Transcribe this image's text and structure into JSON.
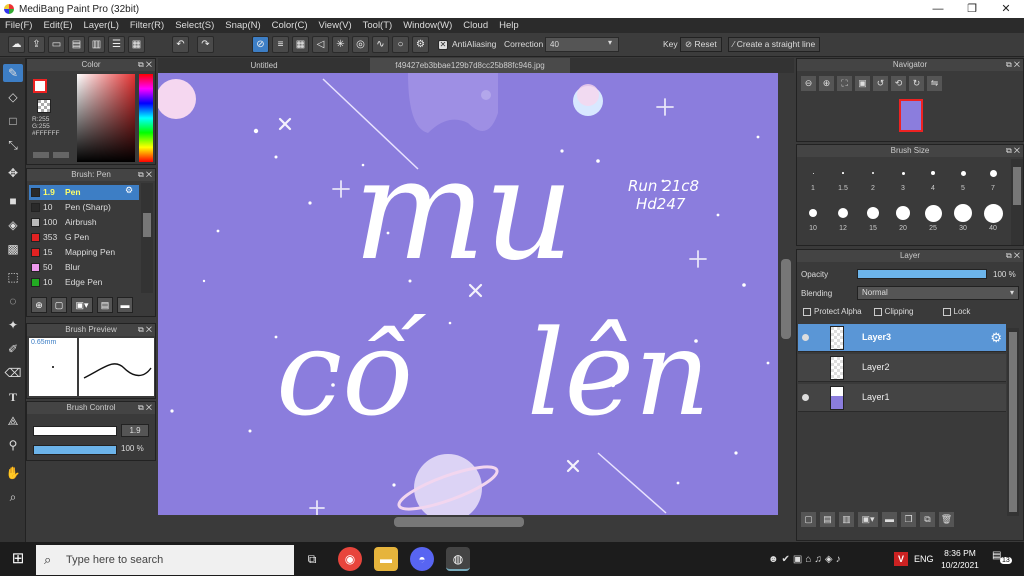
{
  "window": {
    "title": "MediBang Paint Pro (32bit)",
    "minimize": "—",
    "maximize": "❐",
    "close": "✕"
  },
  "menu": [
    "File(F)",
    "Edit(E)",
    "Layer(L)",
    "Filter(R)",
    "Select(S)",
    "Snap(N)",
    "Color(C)",
    "View(V)",
    "Tool(T)",
    "Window(W)",
    "Cloud",
    "Help"
  ],
  "toolbar": {
    "antialiasing_label": "AntiAliasing",
    "correction_label": "Correction",
    "correction_value": "40",
    "key_label": "Key",
    "reset_label": "Reset",
    "straight_line_label": "Create a straight line"
  },
  "color_panel": {
    "title": "Color",
    "r": "R:255",
    "g": "G:255",
    "hex": "#FFFFFF"
  },
  "brush_panel": {
    "title": "Brush: Pen",
    "items": [
      {
        "size": "1.9",
        "name": "Pen",
        "color": "#2a2a2a"
      },
      {
        "size": "10",
        "name": "Pen (Sharp)",
        "color": "#2a2a2a"
      },
      {
        "size": "100",
        "name": "Airbrush",
        "color": "#bbbbbb"
      },
      {
        "size": "353",
        "name": "G Pen",
        "color": "#e22222"
      },
      {
        "size": "15",
        "name": "Mapping Pen",
        "color": "#e22222"
      },
      {
        "size": "50",
        "name": "Blur",
        "color": "#ee99ee"
      },
      {
        "size": "10",
        "name": "Edge Pen",
        "color": "#22aa22"
      }
    ]
  },
  "brush_preview": {
    "title": "Brush Preview",
    "size": "0.65mm"
  },
  "brush_control": {
    "title": "Brush Control",
    "size_value": "1.9",
    "opacity_value": "100 %"
  },
  "canvas": {
    "tab_untitled": "Untitled",
    "tab_file": "f49427eb3bbae129b7d8cc25b88fc946.jpg",
    "text_line1": "mu",
    "text_line2": "cố   lên",
    "signature_line1": "Run 21c8",
    "signature_line2": "Hd247"
  },
  "navigator": {
    "title": "Navigator"
  },
  "brush_size": {
    "title": "Brush Size",
    "row1": [
      "1",
      "1.5",
      "2",
      "3",
      "4",
      "5",
      "7"
    ],
    "row2": [
      "10",
      "12",
      "15",
      "20",
      "25",
      "30",
      "40"
    ]
  },
  "layer_panel": {
    "title": "Layer",
    "opacity_label": "Opacity",
    "opacity_value": "100 %",
    "opacity_fraction": 1.0,
    "blending_label": "Blending",
    "blending_value": "Normal",
    "protect_alpha": "Protect Alpha",
    "clipping": "Clipping",
    "lock": "Lock",
    "layers": [
      {
        "name": "Layer3",
        "visible": true,
        "selected": true
      },
      {
        "name": "Layer2",
        "visible": false,
        "selected": false
      },
      {
        "name": "Layer1",
        "visible": true,
        "selected": false
      }
    ]
  },
  "taskbar": {
    "search_placeholder": "Type here to search",
    "language": "ENG",
    "time": "8:36 PM",
    "date": "10/2/2021",
    "notification_count": "13"
  }
}
